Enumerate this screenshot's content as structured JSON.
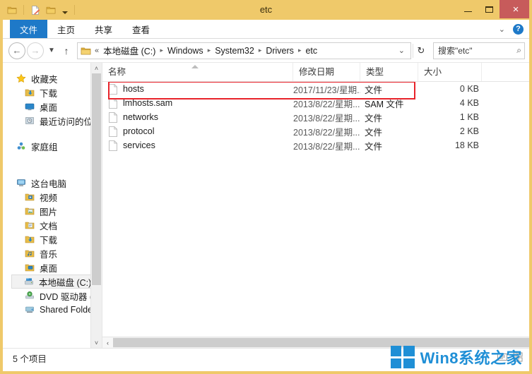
{
  "window": {
    "title": "etc",
    "quick_access": [
      {
        "name": "folder-icon",
        "label": "属性"
      },
      {
        "name": "new-folder-icon",
        "label": "新建文件夹"
      },
      {
        "name": "folder-properties-icon",
        "label": "自定义快速访问工具栏"
      }
    ],
    "caption": {
      "minimize": "–",
      "maximize": "□",
      "close": "×"
    }
  },
  "ribbon": {
    "file_tab": "文件",
    "tabs": [
      "主页",
      "共享",
      "查看"
    ],
    "collapse_label": "⌄",
    "help_label": "?"
  },
  "address": {
    "back": "←",
    "forward": "→",
    "recent": "▼",
    "up": "↑",
    "overflow": "«",
    "crumbs": [
      "本地磁盘 (C:)",
      "Windows",
      "System32",
      "Drivers",
      "etc"
    ],
    "separator": "▸",
    "dropdown": "⌄",
    "refresh": "↻",
    "search_value": "搜索\"etc\"",
    "search_icon": "⌕"
  },
  "sidebar": {
    "groups": [
      {
        "header": {
          "label": "收藏夹",
          "icon": "star-icon"
        },
        "items": [
          {
            "label": "下载",
            "icon": "downloads-folder-icon"
          },
          {
            "label": "桌面",
            "icon": "desktop-icon"
          },
          {
            "label": "最近访问的位置",
            "icon": "recent-places-icon"
          }
        ]
      },
      {
        "header": {
          "label": "家庭组",
          "icon": "homegroup-icon"
        },
        "items": []
      },
      {
        "header": {
          "label": "这台电脑",
          "icon": "this-pc-icon"
        },
        "items": [
          {
            "label": "视频",
            "icon": "videos-folder-icon"
          },
          {
            "label": "图片",
            "icon": "pictures-folder-icon"
          },
          {
            "label": "文档",
            "icon": "documents-folder-icon"
          },
          {
            "label": "下载",
            "icon": "downloads-folder-icon"
          },
          {
            "label": "音乐",
            "icon": "music-folder-icon"
          },
          {
            "label": "桌面",
            "icon": "desktop-folder-icon"
          },
          {
            "label": "本地磁盘 (C:)",
            "icon": "hard-drive-icon",
            "selected": true
          },
          {
            "label": "DVD 驱动器 (D:)",
            "icon": "dvd-drive-icon"
          },
          {
            "label": "Shared Folders",
            "icon": "shared-folder-icon"
          }
        ]
      }
    ],
    "scroll_up": "˄",
    "scroll_down": "˅"
  },
  "filelist": {
    "columns": [
      "名称",
      "修改日期",
      "类型",
      "大小"
    ],
    "rows": [
      {
        "name": "hosts",
        "date": "2017/11/23/星期...",
        "type": "文件",
        "size": "0 KB",
        "highlighted": true
      },
      {
        "name": "lmhosts.sam",
        "date": "2013/8/22/星期...",
        "type": "SAM 文件",
        "size": "4 KB"
      },
      {
        "name": "networks",
        "date": "2013/8/22/星期...",
        "type": "文件",
        "size": "1 KB"
      },
      {
        "name": "protocol",
        "date": "2013/8/22/星期...",
        "type": "文件",
        "size": "2 KB"
      },
      {
        "name": "services",
        "date": "2013/8/22/星期...",
        "type": "文件",
        "size": "18 KB"
      }
    ],
    "scroll_left": "‹",
    "highlight_color": "#e8232a"
  },
  "statusbar": {
    "item_count": "5 个项目"
  },
  "watermark": {
    "text": "Win8系统之家",
    "logo": "windows-logo",
    "color": "#1f8fd6"
  }
}
